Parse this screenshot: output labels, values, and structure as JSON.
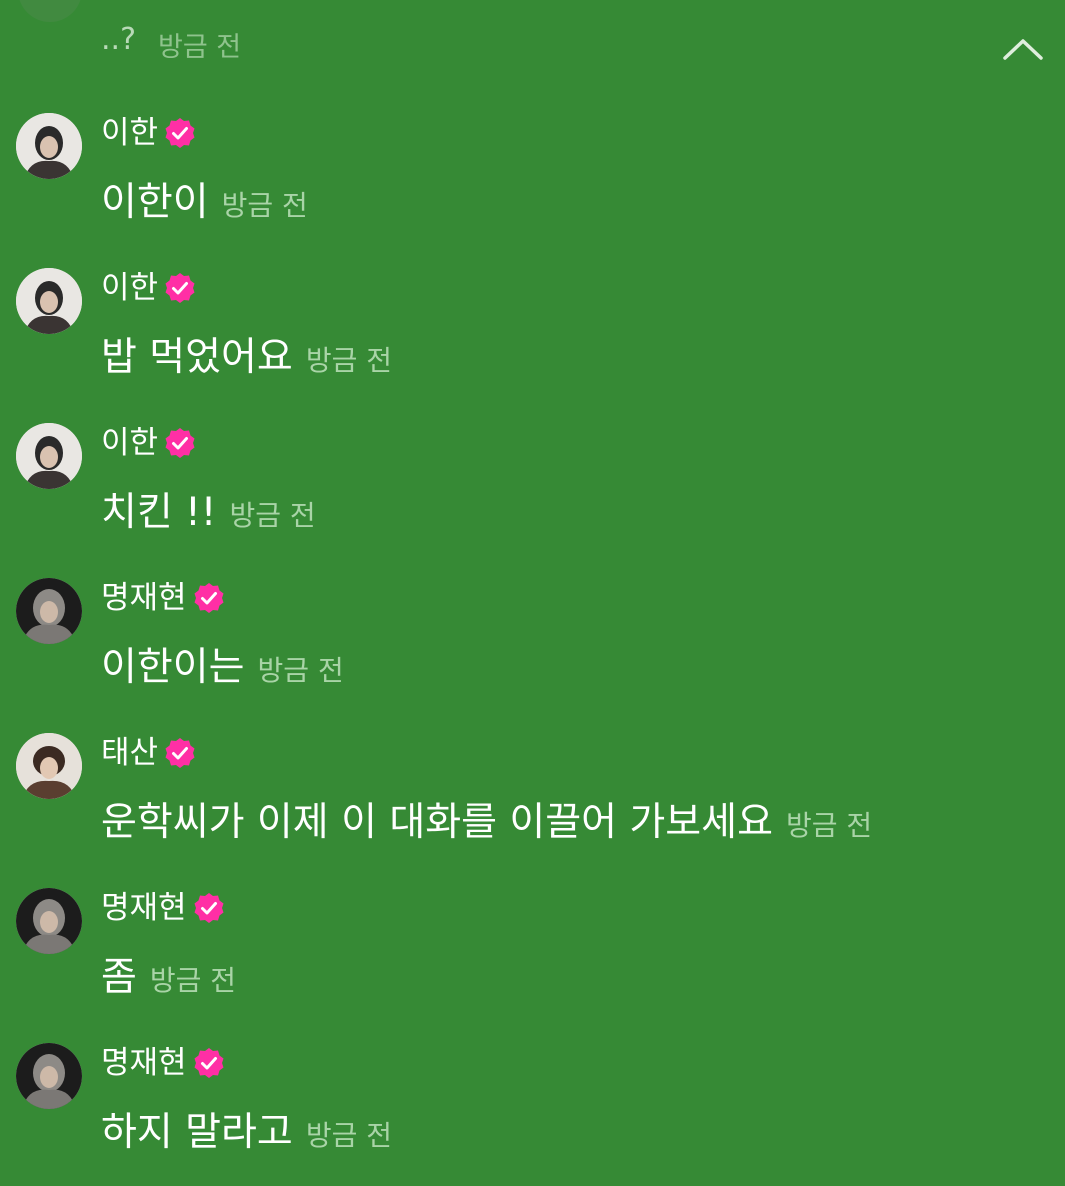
{
  "colors": {
    "background": "#368a35",
    "badge": "#ff2fa5",
    "timestamp": "#a9d4a7"
  },
  "top": {
    "text": "..?",
    "time": "방금 전",
    "collapse_icon": "chevron-up-icon"
  },
  "messages": [
    {
      "name": "이한",
      "text": "이한이",
      "time": "방금 전",
      "avatar": "avatar-light"
    },
    {
      "name": "이한",
      "text": "밥 먹었어요",
      "time": "방금 전",
      "avatar": "avatar-light"
    },
    {
      "name": "이한",
      "text": "치킨 !!",
      "time": "방금 전",
      "avatar": "avatar-light"
    },
    {
      "name": "명재현",
      "text": "이한이는",
      "time": "방금 전",
      "avatar": "avatar-dark"
    },
    {
      "name": "태산",
      "text": "운학씨가 이제 이 대화를 이끌어 가보세요",
      "time": "방금 전",
      "avatar": "avatar-warm"
    },
    {
      "name": "명재현",
      "text": "좀",
      "time": "방금 전",
      "avatar": "avatar-dark"
    },
    {
      "name": "명재현",
      "text": "하지 말라고",
      "time": "방금 전",
      "avatar": "avatar-dark"
    }
  ]
}
